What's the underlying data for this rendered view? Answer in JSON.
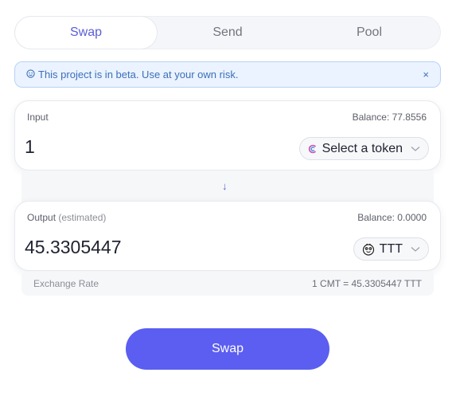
{
  "tabs": [
    {
      "label": "Swap",
      "active": true
    },
    {
      "label": "Send",
      "active": false
    },
    {
      "label": "Pool",
      "active": false
    }
  ],
  "banner": {
    "icon": "smiley-icon",
    "message": "This project is in beta. Use at your own risk.",
    "close_label": "×"
  },
  "input": {
    "label": "Input",
    "balance": "Balance: 77.8556",
    "amount": "1",
    "token_button": "Select a token",
    "token_icon": "token-logo-icon"
  },
  "arrow_icon": "↓",
  "output": {
    "label": "Output",
    "label_note": "(estimated)",
    "balance": "Balance: 0.0000",
    "amount": "45.3305447",
    "token_button": "TTT",
    "token_icon": "ttt-face-icon"
  },
  "exchange_rate": {
    "label": "Exchange Rate",
    "value": "1 CMT = 45.3305447 TTT"
  },
  "swap_button": "Swap",
  "colors": {
    "accent": "#5b5ef0",
    "accent_text": "#5b5ed6",
    "banner_bg": "#eaf3ff",
    "banner_border": "#b9d2f6"
  }
}
